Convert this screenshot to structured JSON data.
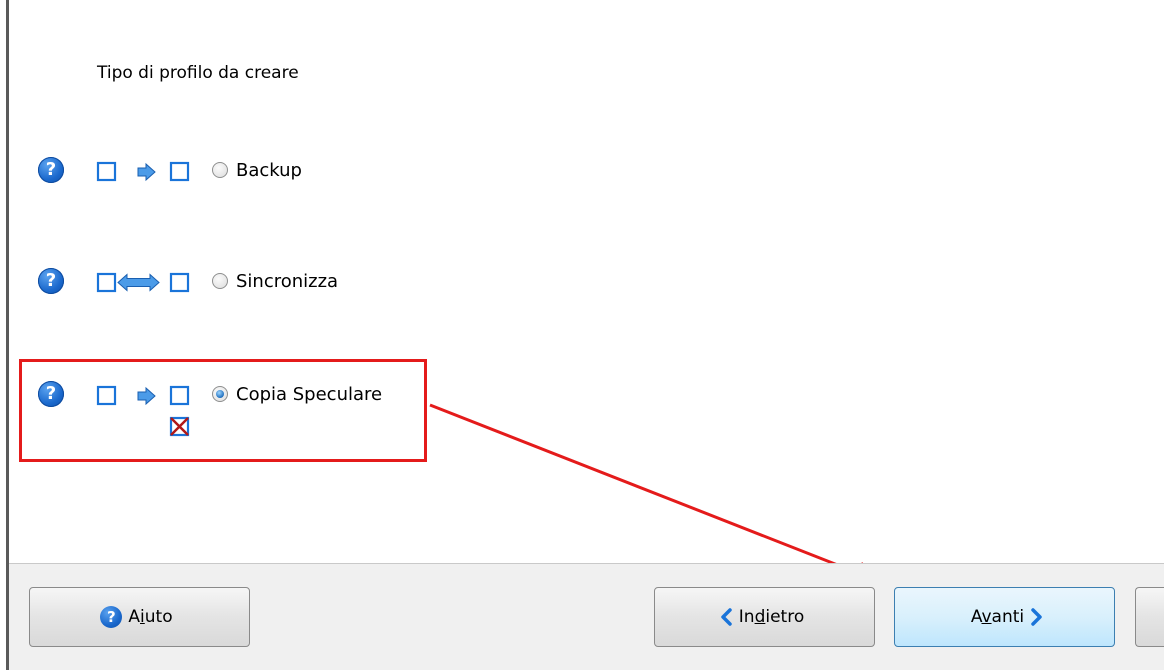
{
  "heading": "Tipo di profilo da creare",
  "options": [
    {
      "key": "backup",
      "label": "Backup",
      "checked": false,
      "pictogram": "backup-arrow-icon"
    },
    {
      "key": "sync",
      "label": "Sincronizza",
      "checked": false,
      "pictogram": "sync-double-arrow-icon"
    },
    {
      "key": "mirror",
      "label": "Copia Speculare",
      "checked": true,
      "pictogram": "mirror-arrow-icon"
    }
  ],
  "buttons": {
    "help": {
      "pre": "A",
      "u": "i",
      "post": "uto"
    },
    "back": {
      "pre": "In",
      "u": "d",
      "post": "ietro"
    },
    "next": {
      "pre": "A",
      "u": "v",
      "post": "anti"
    }
  },
  "colors": {
    "accent": "#1a68cc",
    "annotation": "#e41b1b",
    "footer": "#f0f0f0"
  }
}
